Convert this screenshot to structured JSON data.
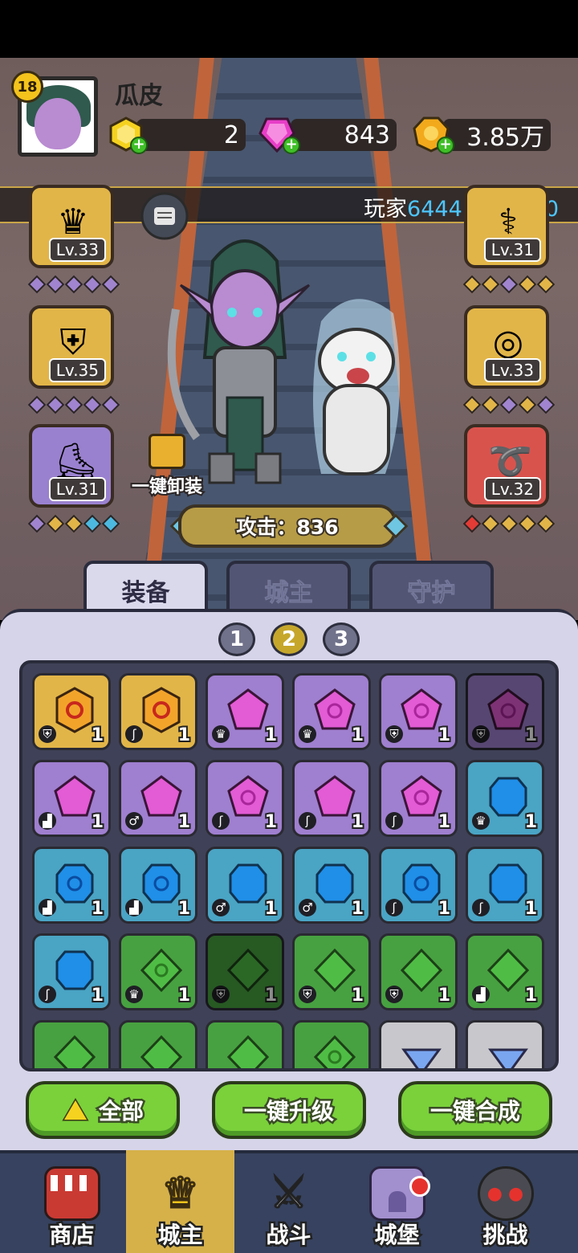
{
  "player": {
    "level": "18",
    "name": "瓜皮",
    "id_prefix": "玩家",
    "id_number": "64441689360"
  },
  "resources": [
    {
      "name": "gold-cube",
      "value": "2",
      "color": "#f5d21f"
    },
    {
      "name": "pink-gem",
      "value": "843",
      "color": "#e83ec8"
    },
    {
      "name": "gold-coin",
      "value": "3.85万",
      "color": "#f2a91b"
    }
  ],
  "equipment_left": [
    {
      "icon": "crown-icon",
      "glyph": "♛",
      "level": "Lv.33",
      "bg": "#e2b548",
      "diamonds": [
        "#a084cf",
        "#a084cf",
        "#a084cf",
        "#a084cf",
        "#a084cf"
      ]
    },
    {
      "icon": "armor-icon",
      "glyph": "⛨",
      "level": "Lv.35",
      "bg": "#e2b548",
      "diamonds": [
        "#a084cf",
        "#a084cf",
        "#a084cf",
        "#a084cf",
        "#a084cf"
      ]
    },
    {
      "icon": "boot-icon",
      "glyph": "⛸",
      "level": "Lv.31",
      "bg": "#9a81cf",
      "diamonds": [
        "#a084cf",
        "#e2b548",
        "#e2b548",
        "#4cb9e0",
        "#4cb9e0"
      ]
    }
  ],
  "equipment_right": [
    {
      "icon": "cane-icon",
      "glyph": "⚕",
      "level": "Lv.31",
      "bg": "#e2b548",
      "diamonds": [
        "#e2b548",
        "#e2b548",
        "#a084cf",
        "#e2b548",
        "#e2b548"
      ]
    },
    {
      "icon": "ring-icon",
      "glyph": "💍",
      "level": "Lv.33",
      "bg": "#e2b548",
      "diamonds": [
        "#e2b548",
        "#e2b548",
        "#a084cf",
        "#e2b548",
        "#a084cf"
      ]
    },
    {
      "icon": "whip-icon",
      "glyph": "➰",
      "level": "Lv.32",
      "bg": "#d9534d",
      "diamonds": [
        "#e33b36",
        "#e2b548",
        "#e2b548",
        "#e2b548",
        "#e2b548"
      ]
    }
  ],
  "unequip_label": "一键卸装",
  "attack_label": "攻击：836",
  "tabs": [
    {
      "label": "装备"
    },
    {
      "label": "城主"
    },
    {
      "label": "守护"
    }
  ],
  "pages": [
    "1",
    "2",
    "3"
  ],
  "grid": [
    [
      {
        "c": "gold",
        "p": "armor",
        "n": "1"
      },
      {
        "c": "gold",
        "p": "cane",
        "n": "1"
      },
      {
        "c": "pink",
        "p": "crown",
        "n": "1"
      },
      {
        "c": "pink2",
        "p": "crown",
        "n": "1"
      },
      {
        "c": "pink2",
        "p": "armor",
        "n": "1"
      },
      {
        "c": "pink2",
        "p": "armor",
        "n": "1",
        "dim": true
      }
    ],
    [
      {
        "c": "pink",
        "p": "boot",
        "n": "1"
      },
      {
        "c": "pink",
        "p": "ring",
        "n": "1"
      },
      {
        "c": "pink2",
        "p": "cane",
        "n": "1"
      },
      {
        "c": "pink",
        "p": "cane",
        "n": "1"
      },
      {
        "c": "pink2",
        "p": "cane",
        "n": "1"
      },
      {
        "c": "blue",
        "p": "crown",
        "n": "1"
      }
    ],
    [
      {
        "c": "blue2",
        "p": "boot",
        "n": "1"
      },
      {
        "c": "blue2",
        "p": "boot",
        "n": "1"
      },
      {
        "c": "blue",
        "p": "ring",
        "n": "1"
      },
      {
        "c": "blue",
        "p": "ring",
        "n": "1"
      },
      {
        "c": "blue2",
        "p": "cane",
        "n": "1"
      },
      {
        "c": "blue",
        "p": "cane",
        "n": "1"
      }
    ],
    [
      {
        "c": "blue",
        "p": "cane",
        "n": "1"
      },
      {
        "c": "green2",
        "p": "crown",
        "n": "1"
      },
      {
        "c": "green",
        "p": "armor",
        "n": "1",
        "dim": true
      },
      {
        "c": "green",
        "p": "armor",
        "n": "1"
      },
      {
        "c": "green",
        "p": "armor",
        "n": "1"
      },
      {
        "c": "green",
        "p": "boot",
        "n": "1"
      }
    ],
    [
      {
        "c": "green",
        "p": "",
        "n": ""
      },
      {
        "c": "green",
        "p": "",
        "n": ""
      },
      {
        "c": "green",
        "p": "",
        "n": ""
      },
      {
        "c": "green2",
        "p": "",
        "n": ""
      },
      {
        "c": "white2",
        "p": "",
        "n": ""
      },
      {
        "c": "white",
        "p": "",
        "n": ""
      }
    ]
  ],
  "actions": {
    "all": "全部",
    "upgrade": "一键升级",
    "merge": "一键合成"
  },
  "nav": [
    {
      "label": "商店",
      "icon": "shop-icon"
    },
    {
      "label": "城主",
      "icon": "crown-icon"
    },
    {
      "label": "战斗",
      "icon": "swords-icon"
    },
    {
      "label": "城堡",
      "icon": "castle-icon"
    },
    {
      "label": "挑战",
      "icon": "monster-icon"
    }
  ]
}
